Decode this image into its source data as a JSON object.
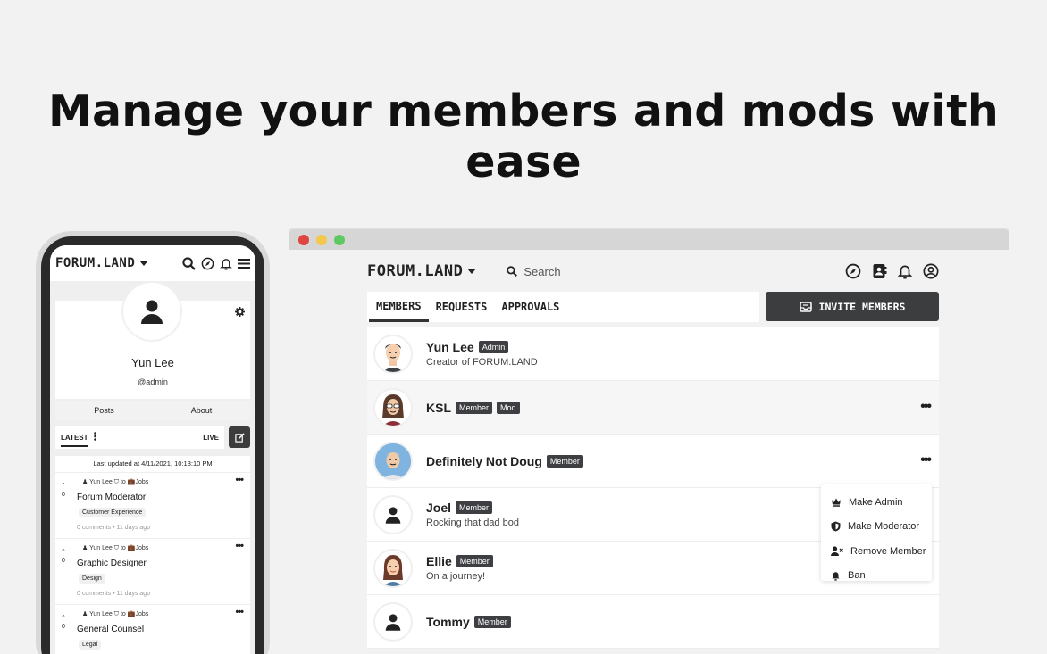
{
  "headline": "Manage your members and mods with ease",
  "colors": {
    "dark": "#3d3f42",
    "window_red": "#e0443e",
    "window_yellow": "#f2c94c",
    "window_green": "#5ec961"
  },
  "phone": {
    "logo": "FORUM.LAND",
    "profile": {
      "name": "Yun Lee",
      "handle": "@admin"
    },
    "tabs": [
      "Posts",
      "About"
    ],
    "feed": {
      "latest": "LATEST",
      "live": "LIVE"
    },
    "updated": "Last updated at 4/11/2021, 10:13:10 PM",
    "posts": [
      {
        "author": "Yun Lee",
        "to": "to",
        "category": "Jobs",
        "title": "Forum Moderator",
        "tag": "Customer Experience",
        "footer": "0 comments • 11 days ago",
        "votes": "0"
      },
      {
        "author": "Yun Lee",
        "to": "to",
        "category": "Jobs",
        "title": "Graphic Designer",
        "tag": "Design",
        "footer": "0 comments • 11 days ago",
        "votes": "0"
      },
      {
        "author": "Yun Lee",
        "to": "to",
        "category": "Jobs",
        "title": "General Counsel",
        "tag": "Legal",
        "footer": "",
        "votes": "0"
      }
    ]
  },
  "browser": {
    "logo": "FORUM.LAND",
    "search_placeholder": "Search",
    "tabs": [
      "MEMBERS",
      "REQUESTS",
      "APPROVALS"
    ],
    "invite_label": "INVITE MEMBERS",
    "members": [
      {
        "name": "Yun Lee",
        "badges": [
          "Admin"
        ],
        "sub": "Creator of FORUM.LAND"
      },
      {
        "name": "KSL",
        "badges": [
          "Member",
          "Mod"
        ],
        "sub": ""
      },
      {
        "name": "Definitely Not Doug",
        "badges": [
          "Member"
        ],
        "sub": ""
      },
      {
        "name": "Joel",
        "badges": [
          "Member"
        ],
        "sub": "Rocking that dad bod"
      },
      {
        "name": "Ellie",
        "badges": [
          "Member"
        ],
        "sub": "On a journey!"
      },
      {
        "name": "Tommy",
        "badges": [
          "Member"
        ],
        "sub": ""
      }
    ],
    "menu": [
      "Make Admin",
      "Make Moderator",
      "Remove Member",
      "Ban"
    ]
  }
}
